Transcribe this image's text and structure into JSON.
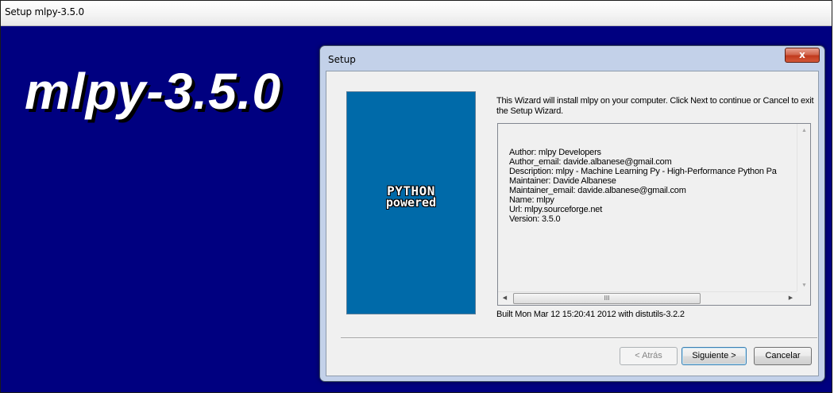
{
  "outer_window": {
    "title": "Setup mlpy-3.5.0",
    "banner_title": "mlpy-3.5.0",
    "banner_color": "#000080"
  },
  "dialog": {
    "title": "Setup",
    "close_label": "x",
    "logo": {
      "line1": "PYTHON",
      "line2": "powered",
      "background": "#006aa9"
    },
    "intro_text": "This Wizard will install mlpy on your computer. Click Next to continue or Cancel to exit the Setup Wizard.",
    "info_lines": [
      "Author: mlpy Developers",
      "Author_email: davide.albanese@gmail.com",
      "Description: mlpy - Machine Learning Py - High-Performance Python Pa",
      "Maintainer: Davide Albanese",
      "Maintainer_email: davide.albanese@gmail.com",
      "Name: mlpy",
      "Url: mlpy.sourceforge.net",
      "Version: 3.5.0"
    ],
    "scroll_thumb_grip": "III",
    "built_text": "Built Mon Mar 12 15:20:41 2012 with distutils-3.2.2",
    "buttons": {
      "back": "< Atrás",
      "next": "Siguiente >",
      "cancel": "Cancelar"
    }
  }
}
